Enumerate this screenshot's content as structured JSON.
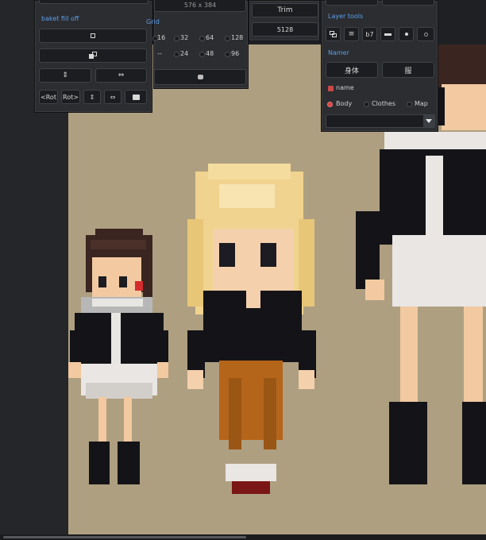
{
  "panel_fill": {
    "section_label": "baket fill off",
    "buttons": [
      {
        "id": "square-fill",
        "icon": "square-icon"
      },
      {
        "id": "copy-fill",
        "icon": "copy-icon"
      },
      {
        "id": "flip-vertical",
        "icon": "flip-vertical-icon"
      },
      {
        "id": "flip-horizontal",
        "icon": "flip-horizontal-icon"
      }
    ],
    "rot_left_label": "<Rot",
    "rot_right_label": "Rot>",
    "small_icons": [
      "flip-vertical-icon",
      "flip-horizontal-icon",
      "thumb-icon"
    ]
  },
  "panel_canvas": {
    "size_label": "576 x 384",
    "grid_label": "Grid",
    "grid_row1": [
      "16",
      "32",
      "64",
      "128"
    ],
    "grid_row2": [
      "--",
      "24",
      "48",
      "96"
    ],
    "selected_grid": "16"
  },
  "panel_trim": {
    "trim_label": "Trim",
    "size_value": "5128"
  },
  "panel_layer": {
    "layer_tools_label": "Layer tools",
    "tool_icons": [
      "layers-icon",
      "stack-icon",
      "b7-icon",
      "minus-icon",
      "dot-icon",
      "circle-icon"
    ],
    "b7_label": "b7",
    "namer_label": "Namer",
    "name_buttons": [
      "身体",
      "服"
    ],
    "name_check_label": "name",
    "options": [
      "Body",
      "Clothes",
      "Map"
    ],
    "selected_option": "Body",
    "dropdown_value": ""
  },
  "colors": {
    "canvas_bg": "#ae9f81",
    "panel_bg": "#2b2d31",
    "accent_blue": "#5f9ee6",
    "accent_red": "#d94545"
  }
}
